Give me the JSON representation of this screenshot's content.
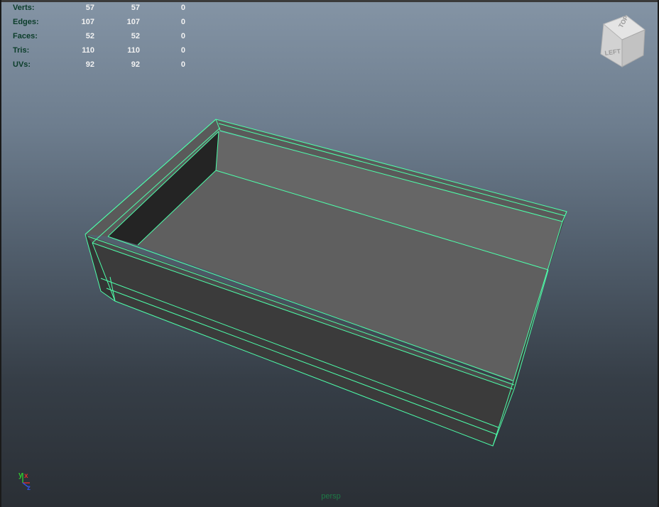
{
  "viewport": {
    "camera_label": "persp",
    "wire_color": "#4dffaa"
  },
  "hud": {
    "rows": [
      {
        "label": "Verts:",
        "values": [
          "57",
          "57",
          "0"
        ]
      },
      {
        "label": "Edges:",
        "values": [
          "107",
          "107",
          "0"
        ]
      },
      {
        "label": "Faces:",
        "values": [
          "52",
          "52",
          "0"
        ]
      },
      {
        "label": "Tris:",
        "values": [
          "110",
          "110",
          "0"
        ]
      },
      {
        "label": "UVs:",
        "values": [
          "92",
          "92",
          "0"
        ]
      }
    ]
  },
  "viewcube": {
    "top_label": "TOP",
    "left_label": "LEFT"
  },
  "axis_indicator": {
    "y": "y",
    "x": "x",
    "z": "z"
  }
}
